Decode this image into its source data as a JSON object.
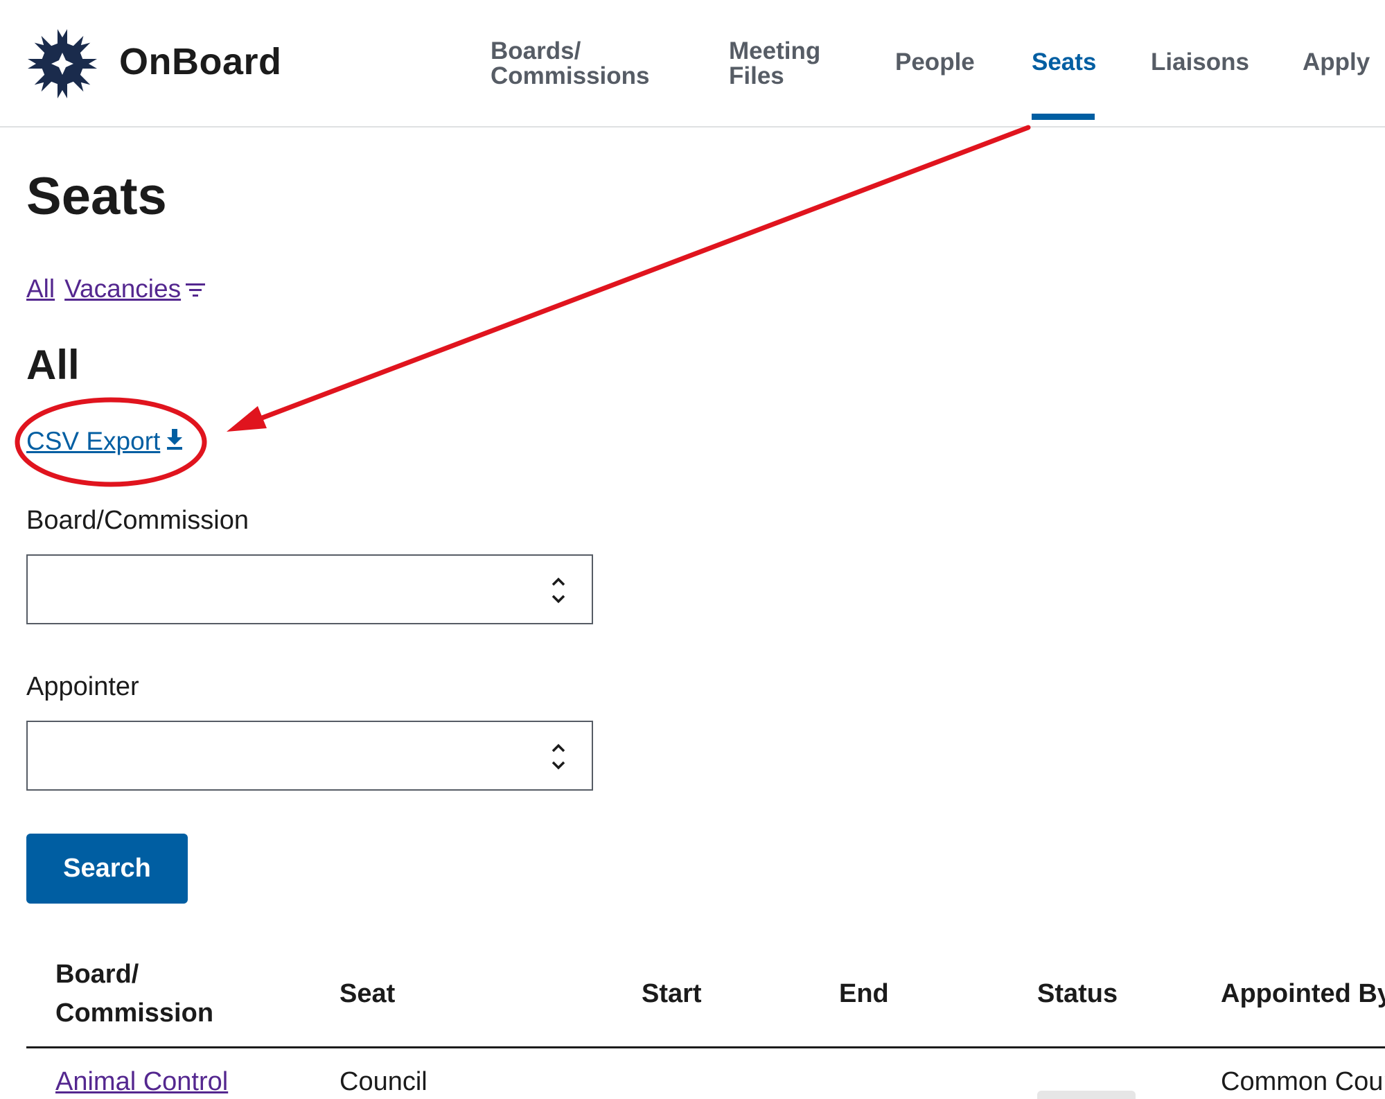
{
  "header": {
    "brand": "OnBoard",
    "nav": [
      {
        "line1": "Boards/",
        "line2": "Commissions"
      },
      {
        "line1": "Meeting",
        "line2": "Files"
      },
      {
        "label": "People"
      },
      {
        "label": "Seats",
        "active": true
      },
      {
        "label": "Liaisons"
      },
      {
        "label": "Apply"
      }
    ]
  },
  "main": {
    "title": "Seats",
    "filters": {
      "all": "All",
      "vacancies": "Vacancies"
    },
    "section_heading": "All",
    "csv_export": "CSV Export",
    "board_label": "Board/Commission",
    "board_value": "",
    "appointer_label": "Appointer",
    "appointer_value": "",
    "search_button": "Search"
  },
  "table": {
    "headers": {
      "board_line1": "Board/",
      "board_line2": "Commission",
      "seat": "Seat",
      "start": "Start",
      "end": "End",
      "status": "Status",
      "appointed_by": "Appointed By"
    },
    "rows": [
      {
        "board": "Animal Control",
        "seat": "Council",
        "start": "",
        "end": "",
        "appointed_by": "Common Council"
      }
    ]
  },
  "colors": {
    "primary": "#005ea2",
    "visited_link": "#54278f",
    "nav_text": "#565c65",
    "annotation": "#e0141e",
    "logo": "#1a2b4c"
  },
  "icons": [
    "logo-icon",
    "filter-icon",
    "download-icon",
    "select-updown-icon"
  ]
}
